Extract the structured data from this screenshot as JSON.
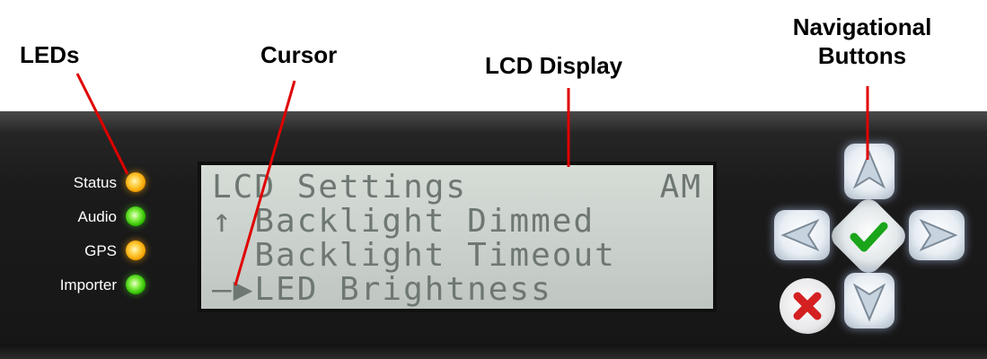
{
  "callouts": {
    "leds": "LEDs",
    "cursor": "Cursor",
    "lcd": "LCD Display",
    "nav_line1": "Navigational",
    "nav_line2": "Buttons"
  },
  "leds": [
    {
      "label": "Status",
      "color": "orange"
    },
    {
      "label": "Audio",
      "color": "green"
    },
    {
      "label": "GPS",
      "color": "orange"
    },
    {
      "label": "Importer",
      "color": "green"
    }
  ],
  "lcd": {
    "title": "LCD Settings",
    "mode": "AM",
    "line2": "↑ Backlight Dimmed",
    "line3": "  Backlight Timeout",
    "line4": "–▶LED Brightness"
  },
  "nav_buttons": [
    "up-arrow-icon",
    "left-arrow-icon",
    "checkmark-icon",
    "right-arrow-icon",
    "down-arrow-icon",
    "cross-icon"
  ],
  "colors": {
    "callout_line": "#e00000",
    "panel": "#1b1b1b",
    "lcd_bg": "#cfd5cf",
    "lcd_text": "#6e7873",
    "check": "#1aa51a",
    "cross": "#d42020"
  }
}
